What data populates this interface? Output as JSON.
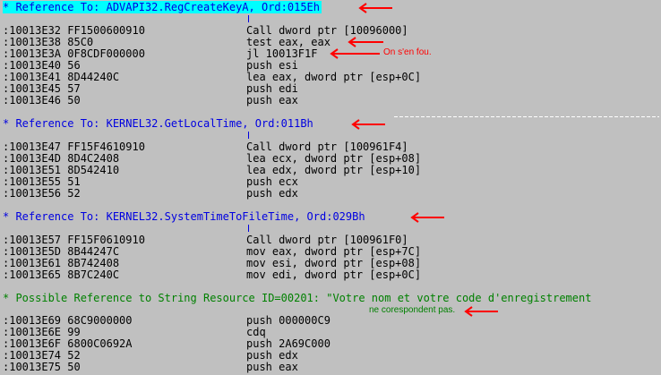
{
  "sections": [
    {
      "reference": "* Reference To: ADVAPI32.RegCreateKeyA, Ord:015Eh",
      "color": "#0000e0",
      "highlighted": true,
      "rows": [
        {
          "addr": ":10013E32 FF1500600910",
          "instr": "Call dword ptr [10096000]"
        },
        {
          "addr": ":10013E38 85C0",
          "instr": "test eax, eax"
        },
        {
          "addr": ":10013E3A 0F8CDF000000",
          "instr": "jl 10013F1F"
        },
        {
          "addr": ":10013E40 56",
          "instr": "push esi"
        },
        {
          "addr": ":10013E41 8D44240C",
          "instr": "lea eax, dword ptr [esp+0C]"
        },
        {
          "addr": ":10013E45 57",
          "instr": "push edi"
        },
        {
          "addr": ":10013E46 50",
          "instr": "push eax"
        }
      ]
    },
    {
      "reference": "* Reference To: KERNEL32.GetLocalTime, Ord:011Bh",
      "color": "#0000e0",
      "highlighted": false,
      "rows": [
        {
          "addr": ":10013E47 FF15F4610910",
          "instr": "Call dword ptr [100961F4]"
        },
        {
          "addr": ":10013E4D 8D4C2408",
          "instr": "lea ecx, dword ptr [esp+08]"
        },
        {
          "addr": ":10013E51 8D542410",
          "instr": "lea edx, dword ptr [esp+10]"
        },
        {
          "addr": ":10013E55 51",
          "instr": "push ecx"
        },
        {
          "addr": ":10013E56 52",
          "instr": "push edx"
        }
      ]
    },
    {
      "reference": "* Reference To: KERNEL32.SystemTimeToFileTime, Ord:029Bh",
      "color": "#0000e0",
      "highlighted": false,
      "rows": [
        {
          "addr": ":10013E57 FF15F0610910",
          "instr": "Call dword ptr [100961F0]"
        },
        {
          "addr": ":10013E5D 8B44247C",
          "instr": "mov eax, dword ptr [esp+7C]"
        },
        {
          "addr": ":10013E61 8B742408",
          "instr": "mov esi, dword ptr [esp+08]"
        },
        {
          "addr": ":10013E65 8B7C240C",
          "instr": "mov edi, dword ptr [esp+0C]"
        }
      ]
    },
    {
      "reference": "* Possible Reference to String Resource ID=00201: \"Votre nom et votre code d'enregistrement",
      "color": "#008000",
      "highlighted": false,
      "rows": [
        {
          "addr": ":10013E69 68C9000000",
          "instr": "push 000000C9"
        },
        {
          "addr": ":10013E6E 99",
          "instr": "cdq"
        },
        {
          "addr": ":10013E6F 6800C0692A",
          "instr": "push 2A69C000"
        },
        {
          "addr": ":10013E74 52",
          "instr": "push edx"
        },
        {
          "addr": ":10013E75 50",
          "instr": "push eax"
        }
      ]
    }
  ],
  "annotations": {
    "jl_note": "On s'en fou.",
    "string_continuation": "ne corespondent pas."
  },
  "colors": {
    "background": "#c0c0c0",
    "reference_blue": "#0000e0",
    "reference_green": "#008000",
    "highlight": "#00ffff",
    "arrow": "#ff0000"
  }
}
